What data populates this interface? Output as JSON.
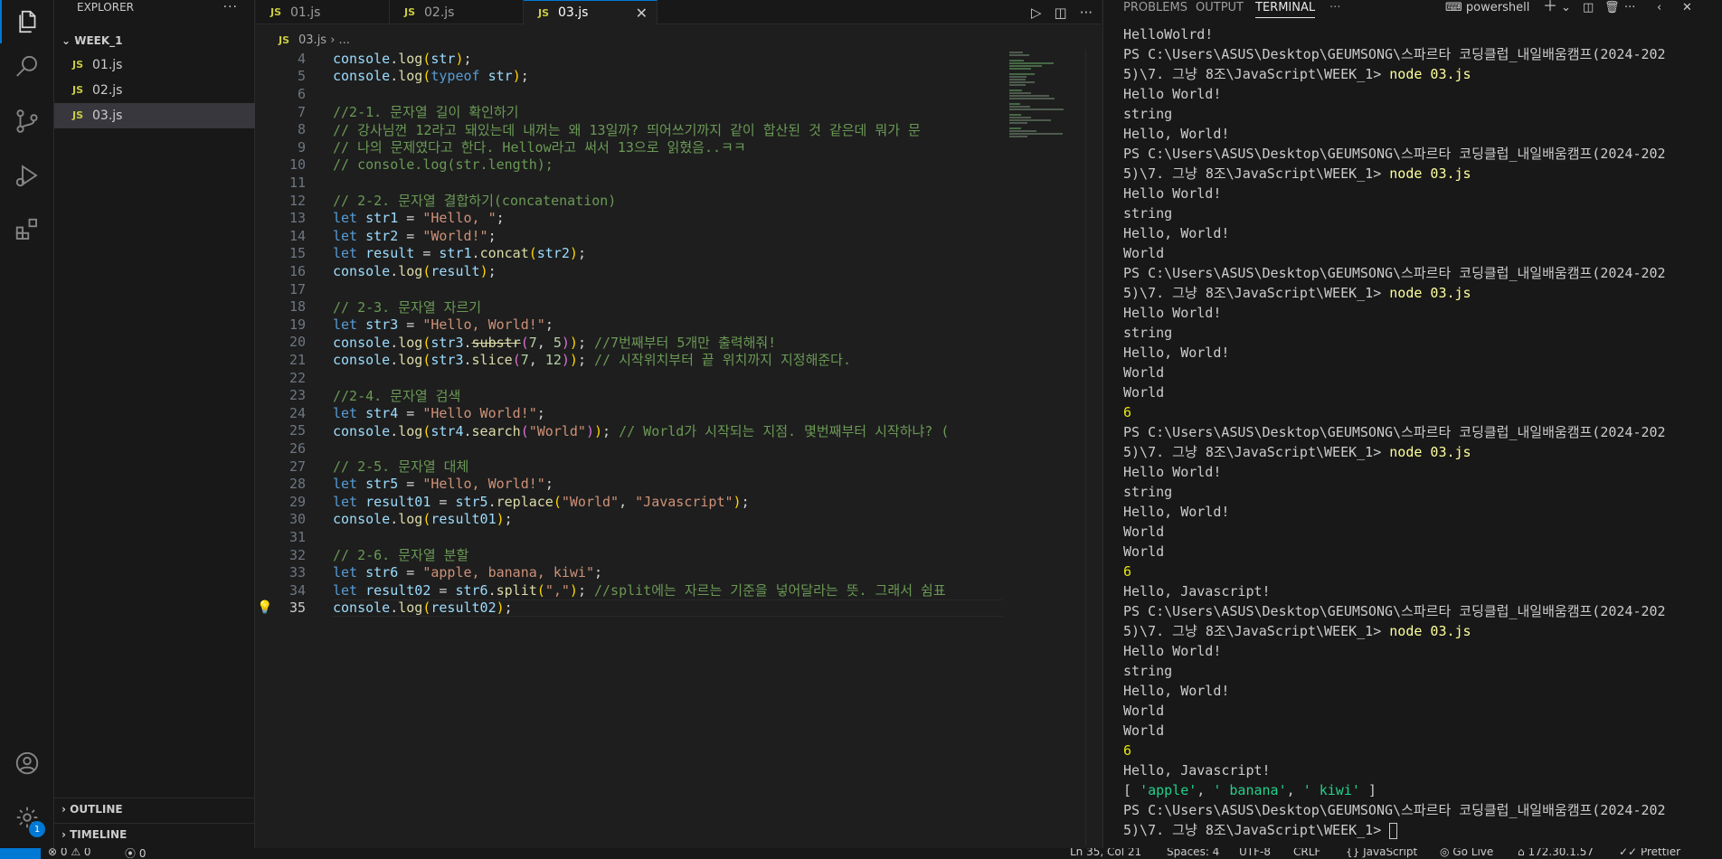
{
  "sidebar": {
    "title": "EXPLORER",
    "folder": "WEEK_1",
    "files": [
      "01.js",
      "02.js",
      "03.js"
    ],
    "outline": "OUTLINE",
    "timeline": "TIMELINE"
  },
  "activity": {
    "badge": "1"
  },
  "tabs": [
    "01.js",
    "02.js",
    "03.js"
  ],
  "js_icon": "JS",
  "breadcrumb": {
    "file": "03.js",
    "rest": "..."
  },
  "editor": {
    "current_line": 35,
    "lines": [
      {
        "n": 4,
        "t": "console.log(str);"
      },
      {
        "n": 5,
        "t": "console.log(typeof str);"
      },
      {
        "n": 6,
        "t": ""
      },
      {
        "n": 7,
        "t": "//2-1. 문자열 길이 확인하기"
      },
      {
        "n": 8,
        "t": "// 강사님껀 12라고 돼있는데 내꺼는 왜 13일까? 띄어쓰기까지 같이 합산된 것 같은데 뭐가 문"
      },
      {
        "n": 9,
        "t": "// 나의 문제였다고 한다. Hellow라고 써서 13으로 읽혔음..ㅋㅋ"
      },
      {
        "n": 10,
        "t": "// console.log(str.length);"
      },
      {
        "n": 11,
        "t": ""
      },
      {
        "n": 12,
        "t": "// 2-2. 문자열 결합하기(concatenation)"
      },
      {
        "n": 13,
        "t": "let str1 = \"Hello, \";"
      },
      {
        "n": 14,
        "t": "let str2 = \"World!\";"
      },
      {
        "n": 15,
        "t": "let result = str1.concat(str2);"
      },
      {
        "n": 16,
        "t": "console.log(result);"
      },
      {
        "n": 17,
        "t": ""
      },
      {
        "n": 18,
        "t": "// 2-3. 문자열 자르기"
      },
      {
        "n": 19,
        "t": "let str3 = \"Hello, World!\";"
      },
      {
        "n": 20,
        "t": "console.log(str3.substr(7, 5)); //7번째부터 5개만 출력해줘!"
      },
      {
        "n": 21,
        "t": "console.log(str3.slice(7, 12)); // 시작위치부터 끝 위치까지 지정해준다."
      },
      {
        "n": 22,
        "t": ""
      },
      {
        "n": 23,
        "t": "//2-4. 문자열 검색"
      },
      {
        "n": 24,
        "t": "let str4 = \"Hello World!\";"
      },
      {
        "n": 25,
        "t": "console.log(str4.search(\"World\")); // World가 시작되는 지점. 몇번째부터 시작하냐? ("
      },
      {
        "n": 26,
        "t": ""
      },
      {
        "n": 27,
        "t": "// 2-5. 문자열 대체"
      },
      {
        "n": 28,
        "t": "let str5 = \"Hello, World!\";"
      },
      {
        "n": 29,
        "t": "let result01 = str5.replace(\"World\", \"Javascript\");"
      },
      {
        "n": 30,
        "t": "console.log(result01);"
      },
      {
        "n": 31,
        "t": ""
      },
      {
        "n": 32,
        "t": "// 2-6. 문자열 분할"
      },
      {
        "n": 33,
        "t": "let str6 = \"apple, banana, kiwi\";"
      },
      {
        "n": 34,
        "t": "let result02 = str6.split(\",\"); //split에는 자르는 기준을 넣어달라는 뜻. 그래서 쉼표"
      },
      {
        "n": 35,
        "t": "console.log(result02);"
      }
    ]
  },
  "panel": {
    "tabs": [
      "PROBLEMS",
      "OUTPUT",
      "TERMINAL"
    ],
    "active_tab": "TERMINAL",
    "shell": "powershell",
    "terminal_lines": [
      {
        "t": "HelloWolrd!"
      },
      {
        "t": "PS C:\\Users\\ASUS\\Desktop\\GEUMSONG\\스파르타 코딩클럽_내일배움캠프(2024-202"
      },
      {
        "t": "5)\\7. 그냥 8조\\JavaScript\\WEEK_1> ",
        "cmd": "node 03.js",
        "dot": "blue"
      },
      {
        "t": "Hello World!"
      },
      {
        "t": "string"
      },
      {
        "t": "Hello, World!"
      },
      {
        "t": "PS C:\\Users\\ASUS\\Desktop\\GEUMSONG\\스파르타 코딩클럽_내일배움캠프(2024-202"
      },
      {
        "t": "5)\\7. 그냥 8조\\JavaScript\\WEEK_1> ",
        "cmd": "node 03.js",
        "dot": "blue"
      },
      {
        "t": "Hello World!"
      },
      {
        "t": "string"
      },
      {
        "t": "Hello, World!"
      },
      {
        "t": "World"
      },
      {
        "t": "PS C:\\Users\\ASUS\\Desktop\\GEUMSONG\\스파르타 코딩클럽_내일배움캠프(2024-202"
      },
      {
        "t": "5)\\7. 그냥 8조\\JavaScript\\WEEK_1> ",
        "cmd": "node 03.js",
        "dot": "blue"
      },
      {
        "t": "Hello World!"
      },
      {
        "t": "string"
      },
      {
        "t": "Hello, World!"
      },
      {
        "t": "World"
      },
      {
        "t": "World"
      },
      {
        "t": "6",
        "color": "yellow"
      },
      {
        "t": "PS C:\\Users\\ASUS\\Desktop\\GEUMSONG\\스파르타 코딩클럽_내일배움캠프(2024-202"
      },
      {
        "t": "5)\\7. 그냥 8조\\JavaScript\\WEEK_1> ",
        "cmd": "node 03.js",
        "dot": "blue"
      },
      {
        "t": "Hello World!"
      },
      {
        "t": "string"
      },
      {
        "t": "Hello, World!"
      },
      {
        "t": "World"
      },
      {
        "t": "World"
      },
      {
        "t": "6",
        "color": "yellow"
      },
      {
        "t": "Hello, Javascript!"
      },
      {
        "t": "PS C:\\Users\\ASUS\\Desktop\\GEUMSONG\\스파르타 코딩클럽_내일배움캠프(2024-202"
      },
      {
        "t": "5)\\7. 그냥 8조\\JavaScript\\WEEK_1> ",
        "cmd": "node 03.js",
        "dot": "blue"
      },
      {
        "t": "Hello World!"
      },
      {
        "t": "string"
      },
      {
        "t": "Hello, World!"
      },
      {
        "t": "World"
      },
      {
        "t": "World"
      },
      {
        "t": "6",
        "color": "yellow"
      },
      {
        "t": "Hello, Javascript!"
      },
      {
        "t": "[ 'apple', ' banana', ' kiwi' ]",
        "color": "array"
      },
      {
        "t": "PS C:\\Users\\ASUS\\Desktop\\GEUMSONG\\스파르타 코딩클럽_내일배움캠프(2024-202",
        "dot": "hollow"
      },
      {
        "t": "5)\\7. 그냥 8조\\JavaScript\\WEEK_1> ",
        "prompt_cursor": true
      }
    ]
  },
  "status": {
    "errors": "0",
    "warnings": "0",
    "ports": "0",
    "position": "Ln 35, Col 21",
    "spaces": "Spaces: 4",
    "encoding": "UTF-8",
    "eol": "CRLF",
    "language": "JavaScript",
    "golive": "Go Live",
    "ip": "172.30.1.57",
    "prettier": "Prettier"
  },
  "colors": {
    "accent": "#0078d4",
    "background": "#1e1e1e",
    "sidebar": "#181818"
  }
}
